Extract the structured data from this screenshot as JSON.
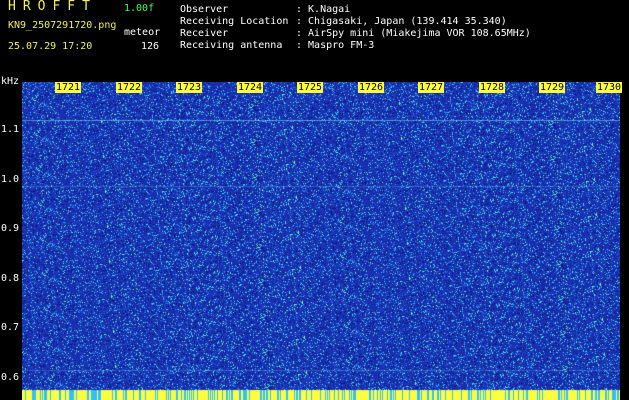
{
  "header": {
    "logo": "HROFFT",
    "version": "1.00f",
    "filename": "KN9_2507291720.png",
    "program": "meteor",
    "datetime": "25.07.29 17:20",
    "count": "126"
  },
  "meta": [
    {
      "label": "Observer",
      "value": ": K.Nagai"
    },
    {
      "label": "Receiving Location",
      "value": ": Chigasaki, Japan (139.414 35.340)"
    },
    {
      "label": "Receiver",
      "value": ": AirSpy mini (Miakejima VOR 108.65MHz)"
    },
    {
      "label": "Receiving antenna",
      "value": ": Maspro FM-3"
    }
  ],
  "axis": {
    "y_unit": "kHz",
    "y_ticks": [
      "1.1",
      "1.0",
      "0.9",
      "0.8",
      "0.7",
      "0.6"
    ],
    "x_ticks": [
      "1721",
      "1722",
      "1723",
      "1724",
      "1725",
      "1726",
      "1727",
      "1728",
      "1729",
      "1730"
    ]
  },
  "colors": {
    "background": "#1a2fb0",
    "noise_light": "#30d0ff",
    "noise_green": "#40ffa0",
    "bottom_band": "#ffff40"
  }
}
